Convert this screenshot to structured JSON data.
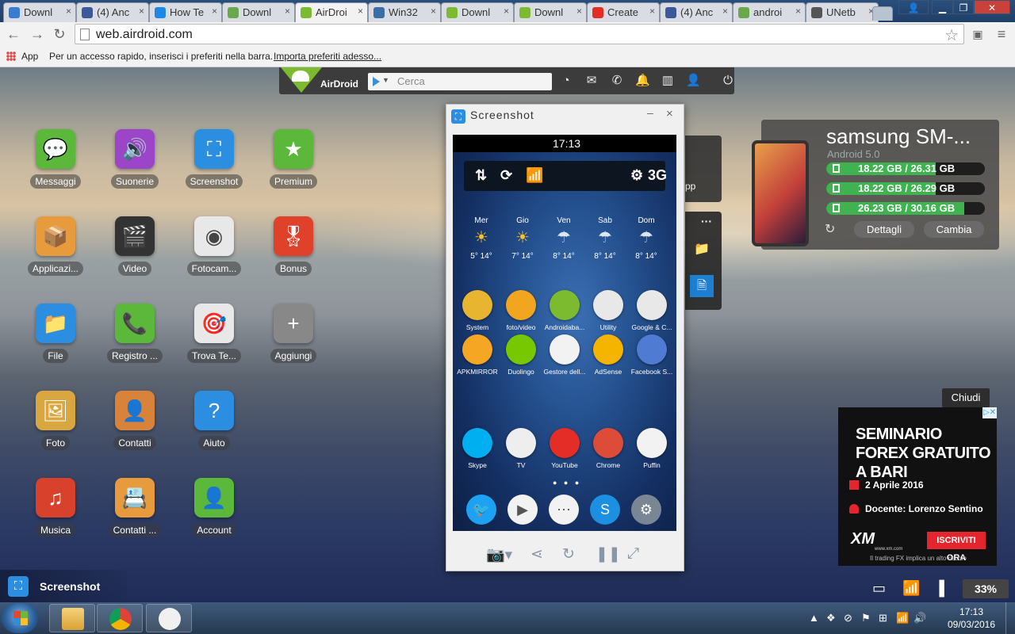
{
  "browser": {
    "tabs": [
      {
        "label": "Downl",
        "favicon_color": "#3a7bd5"
      },
      {
        "label": "(4) Anc",
        "favicon_color": "#3b5998"
      },
      {
        "label": "How Te",
        "favicon_color": "#1e88e5"
      },
      {
        "label": "Downl",
        "favicon_color": "#6aa84f"
      },
      {
        "label": "AirDroi",
        "favicon_color": "#7cbb30"
      },
      {
        "label": "Win32",
        "favicon_color": "#3a6ea5"
      },
      {
        "label": "Downl",
        "favicon_color": "#7cbb30"
      },
      {
        "label": "Downl",
        "favicon_color": "#7cbb30"
      },
      {
        "label": "Create",
        "favicon_color": "#e52d27"
      },
      {
        "label": "(4) Anc",
        "favicon_color": "#3b5998"
      },
      {
        "label": "androi",
        "favicon_color": "#6aa84f"
      },
      {
        "label": "UNetb",
        "favicon_color": "#555555"
      }
    ],
    "close_glyph": "×",
    "window_buttons": {
      "user": "👤",
      "minimize": "▁",
      "maximize": "❐",
      "close": "✕"
    },
    "nav": {
      "back": "←",
      "forward": "→",
      "reload": "↻"
    },
    "url": "web.airdroid.com",
    "star": "☆",
    "bookmarks": {
      "apps_label": "App",
      "hint": "Per un accesso rapido, inserisci i preferiti nella barra.",
      "import_link": "Importa preferiti adesso..."
    }
  },
  "airdroid_bar": {
    "brand": "AirDroid",
    "search_placeholder": "Cerca",
    "icons": [
      "dashboard-icon",
      "messages-icon",
      "phone-icon",
      "notification-icon",
      "devices-icon",
      "user-icon",
      "power-icon"
    ],
    "glyphs": [
      "◔",
      "✉",
      "✆",
      "🔔",
      "▥",
      "👤",
      "⏻"
    ]
  },
  "apps": [
    {
      "label": "Messaggi",
      "color": "#5cb83a",
      "glyph": "💬"
    },
    {
      "label": "Suonerie",
      "color": "#9b45c9",
      "glyph": "🔊"
    },
    {
      "label": "Screenshot",
      "color": "#2c8ee0",
      "glyph": "⛶"
    },
    {
      "label": "Premium",
      "color": "#5cb83a",
      "glyph": "★"
    },
    {
      "label": "Applicazi...",
      "color": "#e89b3c",
      "glyph": "📦"
    },
    {
      "label": "Video",
      "color": "#333333",
      "glyph": "🎬"
    },
    {
      "label": "Fotocam...",
      "color": "#e8e8e8",
      "glyph": "◉"
    },
    {
      "label": "Bonus",
      "color": "#e0412b",
      "glyph": "🎖"
    },
    {
      "label": "File",
      "color": "#2c8ee0",
      "glyph": "📁"
    },
    {
      "label": "Registro ...",
      "color": "#5cb83a",
      "glyph": "📞"
    },
    {
      "label": "Trova Te...",
      "color": "#e8e8e8",
      "glyph": "🎯"
    },
    {
      "label": "Aggiungi",
      "color": "#888888",
      "glyph": "+"
    },
    {
      "label": "Foto",
      "color": "#d9a640",
      "glyph": "🖼"
    },
    {
      "label": "Contatti",
      "color": "#d9823a",
      "glyph": "👤"
    },
    {
      "label": "Aiuto",
      "color": "#2c8ee0",
      "glyph": "?"
    },
    {
      "label": "Musica",
      "color": "#d8412b",
      "glyph": "♫"
    },
    {
      "label": "Contatti ...",
      "color": "#e89b3c",
      "glyph": "📇"
    },
    {
      "label": "Account",
      "color": "#5cb83a",
      "glyph": "👤"
    }
  ],
  "screenshot_window": {
    "title": "Screenshot",
    "minimize": "–",
    "close": "×",
    "phone": {
      "time": "17:13",
      "quick_toggles": [
        "⇅",
        "⟳",
        "📶",
        "⚙",
        "3G"
      ],
      "weather": [
        {
          "day": "Mer",
          "temps": "5° 14°",
          "sym": "☀"
        },
        {
          "day": "Gio",
          "temps": "7° 14°",
          "sym": "☀"
        },
        {
          "day": "Ven",
          "temps": "8° 14°",
          "sym": "☂"
        },
        {
          "day": "Sab",
          "temps": "8° 14°",
          "sym": "☂"
        },
        {
          "day": "Dom",
          "temps": "8° 14°",
          "sym": "☂"
        }
      ],
      "apps": [
        {
          "label": "System",
          "color": "#e8b531"
        },
        {
          "label": "foto/video",
          "color": "#f2a51e"
        },
        {
          "label": "Androidaba...",
          "color": "#7cbb30"
        },
        {
          "label": "Utility",
          "color": "#e8e8e8"
        },
        {
          "label": "Google & C...",
          "color": "#e8e8e8"
        },
        {
          "label": "APKMIRROR",
          "color": "#f5a623"
        },
        {
          "label": "Duolingo",
          "color": "#78c800"
        },
        {
          "label": "Gestore dell...",
          "color": "#f2f2f2"
        },
        {
          "label": "AdSense",
          "color": "#f5b400"
        },
        {
          "label": "Facebook S...",
          "color": "#4f7bd3"
        },
        {
          "label": "Skype",
          "color": "#00aff0"
        },
        {
          "label": "TV",
          "color": "#eeeeee"
        },
        {
          "label": "YouTube",
          "color": "#e52d27"
        },
        {
          "label": "Chrome",
          "color": "#dd4b39"
        },
        {
          "label": "Puffin",
          "color": "#f2f2f2"
        }
      ],
      "dock": [
        {
          "name": "twitter",
          "color": "#1da1f2",
          "glyph": "🐦"
        },
        {
          "name": "play-store",
          "color": "#f2f2f2",
          "glyph": "▶"
        },
        {
          "name": "app-drawer",
          "color": "#f2f2f2",
          "glyph": "⋯"
        },
        {
          "name": "shazam",
          "color": "#1c8fe0",
          "glyph": "S"
        },
        {
          "name": "settings",
          "color": "#7a8694",
          "glyph": "⚙"
        }
      ]
    },
    "tools": [
      "📷▾",
      "⋖",
      "↻",
      "❚❚",
      "⤢"
    ]
  },
  "device": {
    "name": "samsung SM-...",
    "os": "Android 5.0",
    "storage": [
      {
        "value": "18.22 GB / 26.31 GB",
        "fraction": 0.69
      },
      {
        "value": "18.22 GB / 26.29 GB",
        "fraction": 0.69
      },
      {
        "value": "26.23 GB / 30.16 GB",
        "fraction": 0.87
      }
    ],
    "refresh": "↻",
    "details_button": "Dettagli",
    "change_button": "Cambia"
  },
  "side_panel": {
    "app_label": "pp",
    "more": "···",
    "folder": "📁",
    "doc": "🗎"
  },
  "ad": {
    "close_label": "Chiudi",
    "adchoice": "▷✕",
    "headline": "SEMINARIO FOREX GRATUITO A BARI",
    "date": "2 Aprile 2016",
    "teacher": "Docente: Lorenzo Sentino",
    "brand": "XM",
    "brand_url": "www.xm.com",
    "cta": "ISCRIVITI ORA",
    "disclaimer": "Il trading FX implica un alto rischio"
  },
  "bottom_bar": {
    "screenshot_label": "Screenshot",
    "battery": "33%",
    "status_icons": [
      "▭",
      "📶",
      "▐"
    ]
  },
  "taskbar": {
    "tray_icons": [
      "▲",
      "❖",
      "⊘",
      "⚑",
      "⊞",
      "📶",
      "🔊"
    ],
    "time": "17:13",
    "date": "09/03/2016"
  }
}
